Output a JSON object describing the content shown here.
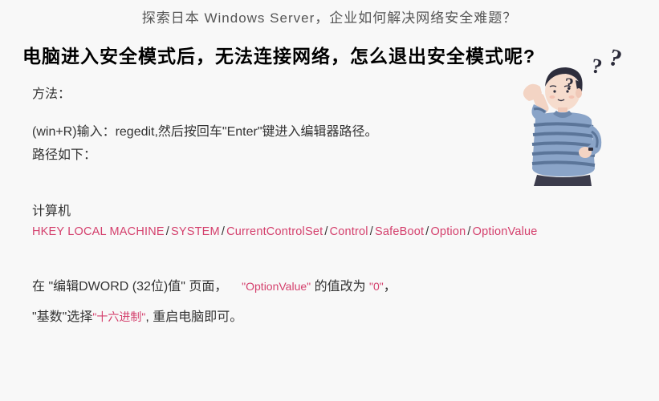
{
  "banner": "探索日本 Windows Server，企业如何解决网络安全难题？",
  "heading": "电脑进入安全模式后，无法连接网络，怎么退出安全模式呢?",
  "method_label": "方法：",
  "step1": "(win+R)输入：regedit,然后按回车\"Enter\"键进入编辑器路径。",
  "path_label": "路径如下：",
  "computer_label": "计算机",
  "reg_path": {
    "p1": "HKEY LOCAL MACHINE",
    "p2": "SYSTEM",
    "p3": "CurrentControlSet",
    "p4": "Control",
    "p5": "SafeBoot",
    "p6": "Option",
    "p7": "OptionValue"
  },
  "edit": {
    "a1": "在 \"编辑DWORD (32位)值\" 页面，",
    "a2": "\"OptionValue\"",
    "a3": " 的值改为 ",
    "a4": "\"0\"",
    "a5": "，",
    "b1": "\"基数\"选择",
    "b2": "\"十六进制\"",
    "b3": ", 重启电脑即可。"
  },
  "illus": {
    "q": "?"
  }
}
